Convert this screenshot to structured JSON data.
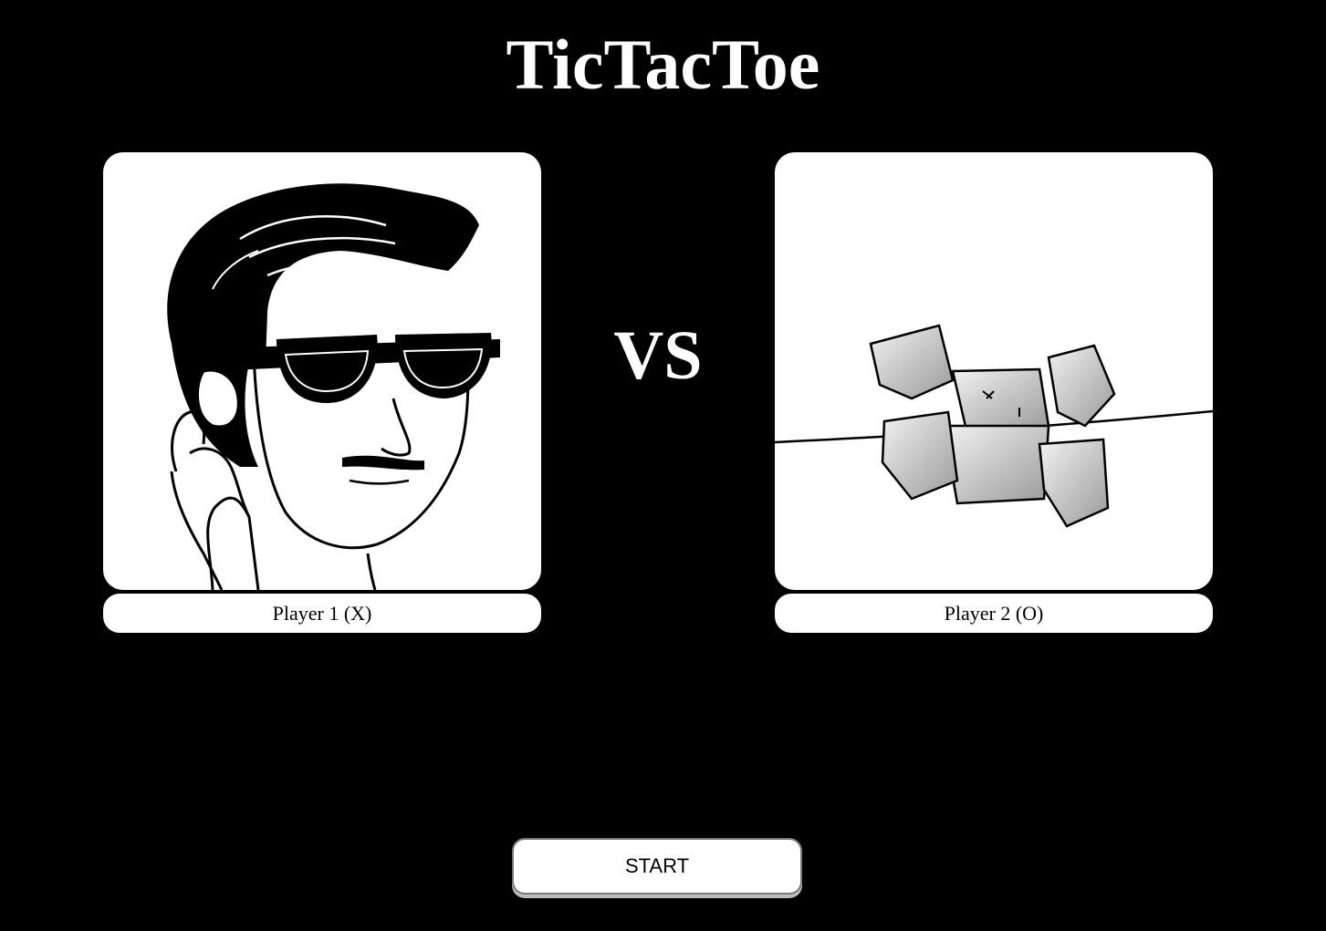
{
  "title": "TicTacToe",
  "vs_label": "VS",
  "players": [
    {
      "label": "Player 1 (X)",
      "avatar": "cool-guy-sunglasses-drawing"
    },
    {
      "label": "Player 2 (O)",
      "avatar": "robot-crab-drawing"
    }
  ],
  "start_label": "START",
  "colors": {
    "background": "#000000",
    "card": "#ffffff",
    "text_light": "#ffffff",
    "text_dark": "#000000"
  }
}
